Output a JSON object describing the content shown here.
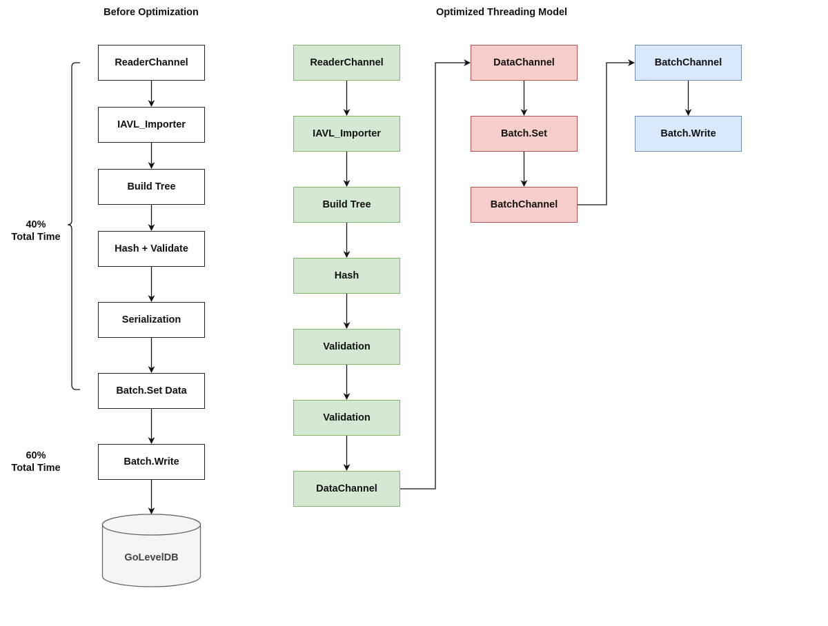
{
  "titles": {
    "before": "Before Optimization",
    "optimized": "Optimized Threading Model"
  },
  "colors": {
    "plain_fill": "#ffffff",
    "plain_stroke": "#222222",
    "green_fill": "#d5e8d4",
    "green_stroke": "#82b366",
    "red_fill": "#f8cecc",
    "red_stroke": "#b85450",
    "blue_fill": "#dae8fc",
    "blue_stroke": "#6c8ebf",
    "db_fill": "#f5f5f5",
    "db_stroke": "#666666"
  },
  "before": {
    "nodes": [
      "ReaderChannel",
      "IAVL_Importer",
      "Build Tree",
      "Hash + Validate",
      "Serialization",
      "Batch.Set Data",
      "Batch.Write"
    ],
    "database": "GoLevelDB",
    "annotations": [
      {
        "percent": "40%",
        "label": "Total Time",
        "spans": "ReaderChannel – Batch.Set Data"
      },
      {
        "percent": "60%",
        "label": "Total Time",
        "spans": "Batch.Write"
      }
    ]
  },
  "optimized": {
    "lane1": [
      "ReaderChannel",
      "IAVL_Importer",
      "Build Tree",
      "Hash",
      "Validation",
      "Validation",
      "DataChannel"
    ],
    "lane2": [
      "DataChannel",
      "Batch.Set",
      "BatchChannel"
    ],
    "lane3": [
      "BatchChannel",
      "Batch.Write"
    ],
    "connections": [
      {
        "from": "lane1.DataChannel",
        "to": "lane2.DataChannel"
      },
      {
        "from": "lane2.BatchChannel",
        "to": "lane3.BatchChannel"
      }
    ]
  }
}
